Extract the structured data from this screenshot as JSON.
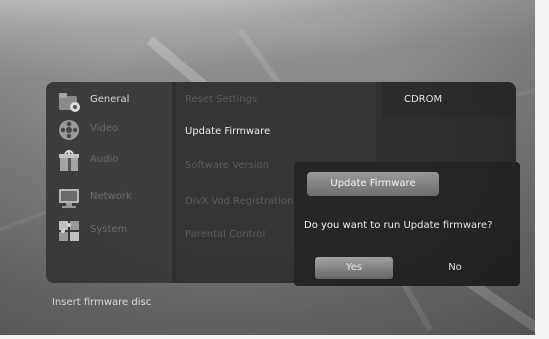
{
  "categories": [
    {
      "label": "General",
      "icon": "folder-settings-icon"
    },
    {
      "label": "Video",
      "icon": "film-reel-icon"
    },
    {
      "label": "Audio",
      "icon": "music-gift-icon"
    },
    {
      "label": "Network",
      "icon": "monitor-network-icon"
    },
    {
      "label": "System",
      "icon": "puzzle-pieces-icon"
    }
  ],
  "options": [
    {
      "label": "Reset Settings"
    },
    {
      "label": "Update Firmware"
    },
    {
      "label": "Software Version"
    },
    {
      "label": "DivX Vod Registration"
    },
    {
      "label": "Parental Control"
    }
  ],
  "tab": {
    "label": "CDROM"
  },
  "dialog": {
    "title": "Update Firmware",
    "question": "Do you want to run Update firmware?",
    "yes_label": "Yes",
    "no_label": "No"
  },
  "status": {
    "text": "Insert firmware disc"
  }
}
